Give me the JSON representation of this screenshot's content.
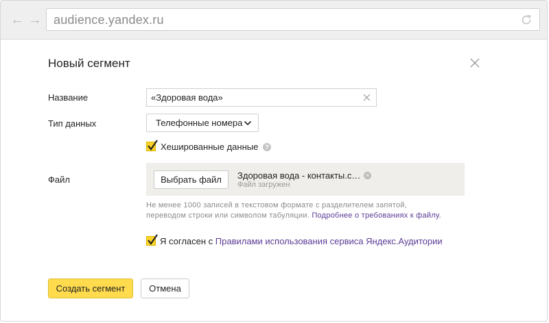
{
  "browser": {
    "url": "audience.yandex.ru"
  },
  "dialog": {
    "title": "Новый сегмент",
    "name_label": "Название",
    "name_value": "«Здоровая вода»",
    "data_type_label": "Тип данных",
    "data_type_value": "Телефонные номера",
    "hashed_label": "Хешированные данные",
    "hashed_checked": true,
    "file_label": "Файл",
    "choose_file_label": "Выбрать файл",
    "file_name": "Здоровая вода - контакты.c…",
    "file_status": "Файл загружен",
    "hint_text": "Не менее 1000 записей в текстовом формате с разделителем запятой, переводом строки или символом табуляции.",
    "hint_link": "Подробнее о требованиях к файлу.",
    "agree_prefix": "Я согласен с",
    "agree_link": "Правилами использования сервиса Яндекс.Аудитории",
    "agree_checked": true,
    "create_label": "Создать сегмент",
    "cancel_label": "Отмена"
  },
  "colors": {
    "accent_yellow": "#ffdb4d",
    "link_purple": "#5b3a94",
    "check_yellow": "#ffd426"
  }
}
